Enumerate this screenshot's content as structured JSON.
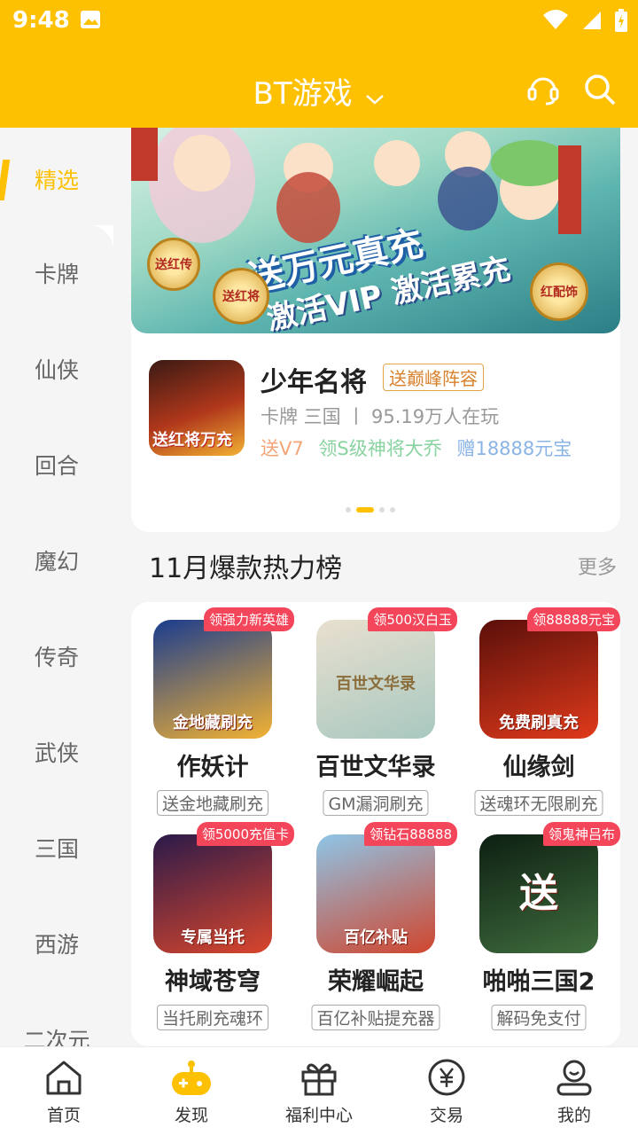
{
  "status": {
    "time": "9:48"
  },
  "header": {
    "title": "BT游戏"
  },
  "sidebar": {
    "items": [
      {
        "label": "精选"
      },
      {
        "label": "卡牌"
      },
      {
        "label": "仙侠"
      },
      {
        "label": "回合"
      },
      {
        "label": "魔幻"
      },
      {
        "label": "传奇"
      },
      {
        "label": "武侠"
      },
      {
        "label": "三国"
      },
      {
        "label": "西游"
      },
      {
        "label": "二次元"
      }
    ]
  },
  "banner": {
    "headline": "送万元真充",
    "subline": "激活VIP 激活累充",
    "medals": [
      "送红传",
      "送红将",
      "红配饰"
    ],
    "thumb_text": "送红将万充",
    "game_name": "少年名将",
    "game_tag": "送巅峰阵容",
    "game_meta": "卡牌 三国 丨 95.19万人在玩",
    "perks": [
      "送V7",
      "领S级神将大乔",
      "赠18888元宝"
    ]
  },
  "section": {
    "title": "11月爆款热力榜",
    "more": "更多"
  },
  "games": [
    {
      "name": "作妖计",
      "badge": "领强力新英雄",
      "tag": "送金地藏刷充",
      "thumb_text": "金地藏刷充",
      "colors": [
        "#1a3c8f",
        "#f2b233"
      ]
    },
    {
      "name": "百世文华录",
      "badge": "领500汉白玉",
      "tag": "GM漏洞刷充",
      "thumb_text": "百世文华录",
      "colors": [
        "#e9e0cf",
        "#a8c8c0"
      ]
    },
    {
      "name": "仙缘剑",
      "badge": "领88888元宝",
      "tag": "送魂环无限刷充",
      "thumb_text": "免费刷真充",
      "colors": [
        "#5a0f0a",
        "#e03a1b"
      ]
    },
    {
      "name": "神域苍穹",
      "badge": "领5000充值卡",
      "tag": "当托刷充魂环",
      "thumb_text": "专属当托",
      "colors": [
        "#2a1a4a",
        "#d9462c"
      ]
    },
    {
      "name": "荣耀崛起",
      "badge": "领钻石88888",
      "tag": "百亿补贴提充器",
      "thumb_text": "百亿补贴",
      "colors": [
        "#8ec6e8",
        "#d0452d"
      ]
    },
    {
      "name": "啪啪三国2",
      "badge": "领鬼神吕布",
      "tag": "解码免支付",
      "thumb_text": "送",
      "colors": [
        "#0d1f12",
        "#3f6d3d"
      ]
    }
  ],
  "bottom_nav": [
    {
      "label": "首页",
      "icon": "home-icon"
    },
    {
      "label": "发现",
      "icon": "gamepad-icon"
    },
    {
      "label": "福利中心",
      "icon": "gift-icon"
    },
    {
      "label": "交易",
      "icon": "yen-icon"
    },
    {
      "label": "我的",
      "icon": "profile-icon"
    }
  ],
  "colors": {
    "accent": "#fec101",
    "badge": "#f4465a",
    "background": "#f5f5f5"
  }
}
